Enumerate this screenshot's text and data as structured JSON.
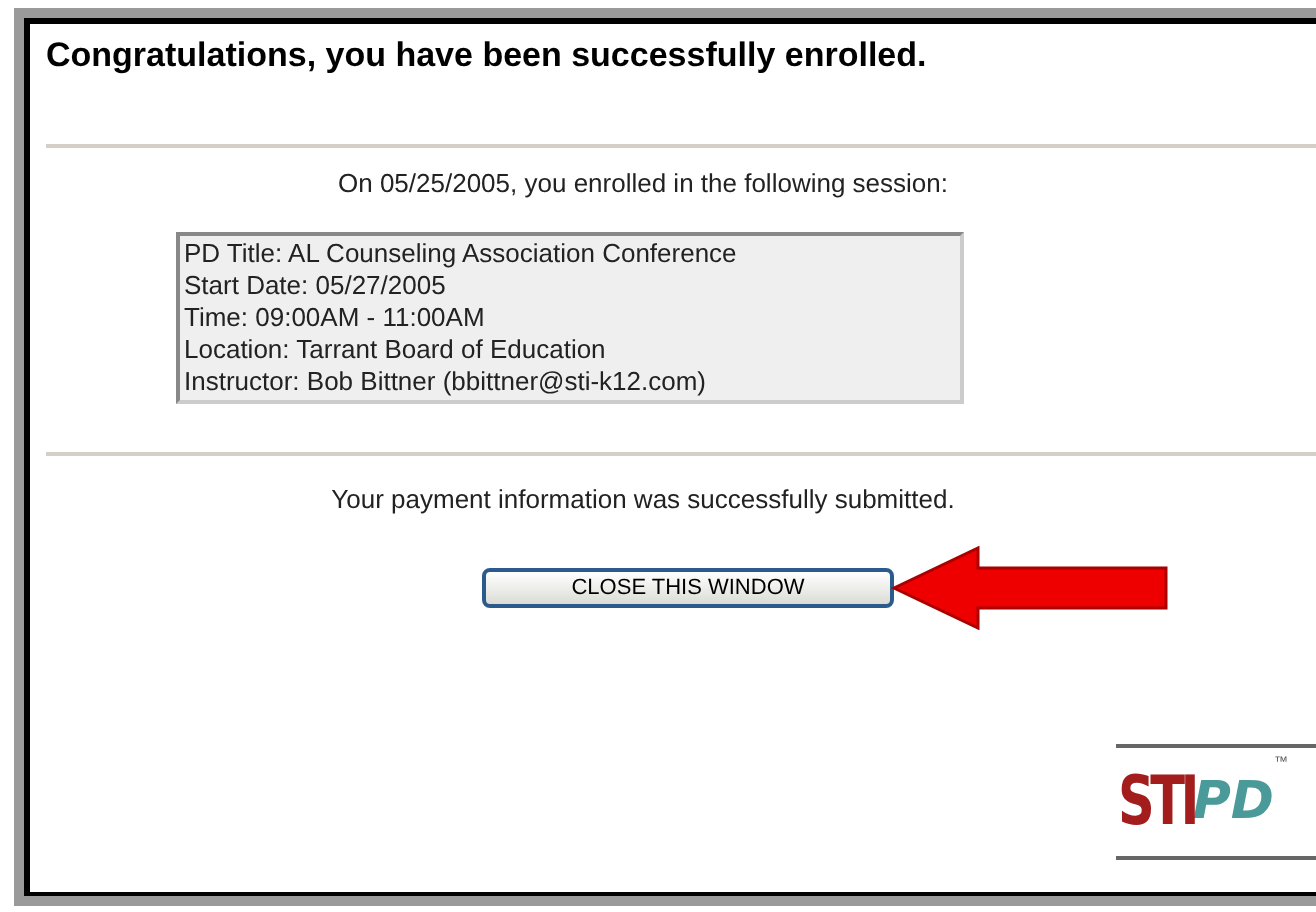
{
  "heading": "Congratulations, you have been successfully enrolled.",
  "enrolled_message": "On 05/25/2005, you enrolled in the following session:",
  "session_details": [
    "PD Title: AL Counseling Association Conference",
    "Start Date: 05/27/2005",
    "Time: 09:00AM - 11:00AM",
    "Location: Tarrant Board of Education",
    "Instructor: Bob Bittner (bbittner@sti-k12.com)"
  ],
  "payment_message": "Your payment information was successfully submitted.",
  "close_button": "CLOSE THIS WINDOW",
  "logo": {
    "part_1": "STI",
    "part_2": "PD",
    "trademark": "™"
  }
}
